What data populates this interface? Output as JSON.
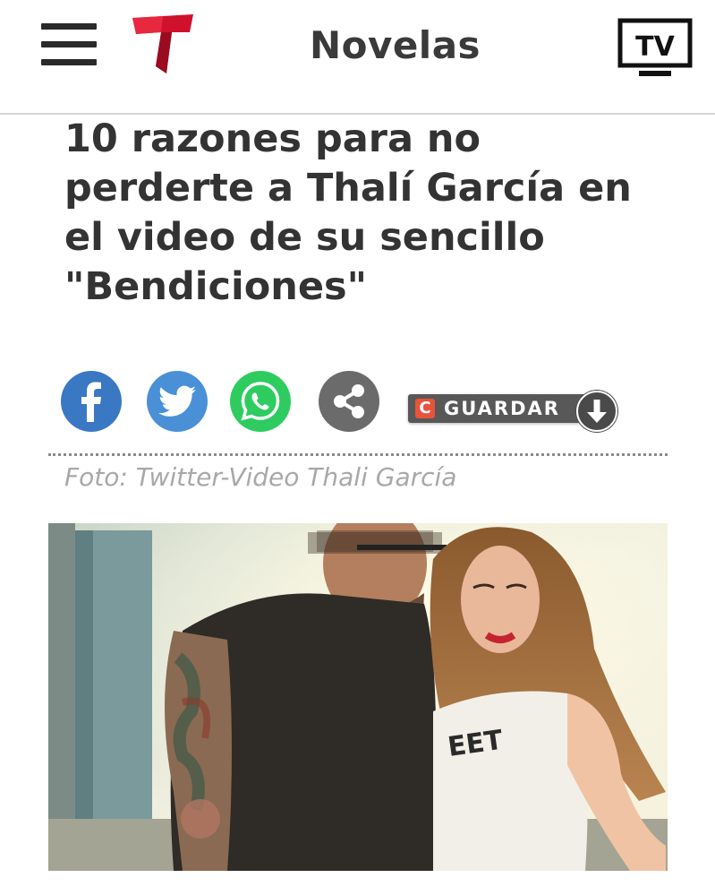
{
  "header": {
    "menu_icon": "hamburger-menu-icon",
    "logo_icon": "telemundo-t-logo",
    "section_title": "Novelas",
    "tv_label": "TV"
  },
  "article": {
    "headline": "10 razones para no perderte a Thalí García en el video de su sencillo \"Bendiciones\"",
    "share": {
      "facebook_icon": "facebook-icon",
      "twitter_icon": "twitter-icon",
      "whatsapp_icon": "whatsapp-icon",
      "share_icon": "share-icon",
      "save_letter": "C",
      "save_label": "GUARDAR"
    },
    "photo_caption": "Foto: Twitter-Video Thali García"
  },
  "colors": {
    "brand_red": "#d0112b",
    "facebook": "#3b78c4",
    "twitter": "#4a90d6",
    "whatsapp": "#2ecc5f",
    "share": "#6b6b6b",
    "text_dark": "#333333",
    "caption_gray": "#a8a8a8"
  }
}
